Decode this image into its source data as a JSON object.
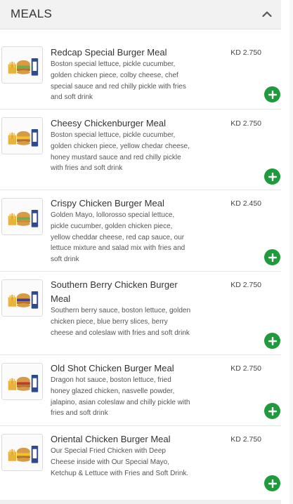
{
  "section": {
    "title": "MEALS",
    "collapse_icon": "chevron-up-icon"
  },
  "meals": [
    {
      "name": "Redcap Special Burger Meal",
      "price": "KD 2.750",
      "description": "Boston special lettuce, pickle cucumber, golden chicken piece, colby cheese, chef special sauce and red chilly pickle with fries and soft drink"
    },
    {
      "name": "Cheesy Chickenburger Meal",
      "price": "KD 2.750",
      "description": "Boston special lettuce, pickle cucumber, golden chicken piece, yellow chedar cheese, honey mustard sauce and red chilly pickle with fries and soft drink"
    },
    {
      "name": "Crispy Chicken Burger Meal",
      "price": "KD 2.450",
      "description": "Golden Mayo, lollorosso special lettuce, pickle cucumber, golden chicken piece, yellow cheddar cheese, red cap sauce, our lettuce mixture and salad mix with fries and soft drink"
    },
    {
      "name": "Southern Berry Chicken Burger Meal",
      "price": "KD 2.750",
      "description": "Southern berry sauce, boston lettuce, golden chicken piece, blue berry slices, berry cheese and coleslaw with fries and soft drink"
    },
    {
      "name": "Old Shot Chicken Burger Meal",
      "price": "KD 2.750",
      "description": "Dragon hot sauce, boston lettuce, fried honey glazed chicken, nasvelle powder, jalapino, asian coleslaw and chilly pickle with fries and soft drink"
    },
    {
      "name": "Oriental Chicken Burger Meal",
      "price": "KD 2.750",
      "description": "Our Special Fried Chicken with Deep Cheese inside with Our Special Mayo, Ketchup & Lettuce with Fries and Soft Drink."
    }
  ],
  "colors": {
    "add_button": "#1f9a3c",
    "header_bg": "#f2f2f2"
  },
  "icons": {
    "add": "plus-icon",
    "thumbnail": "burger-meal-image"
  }
}
